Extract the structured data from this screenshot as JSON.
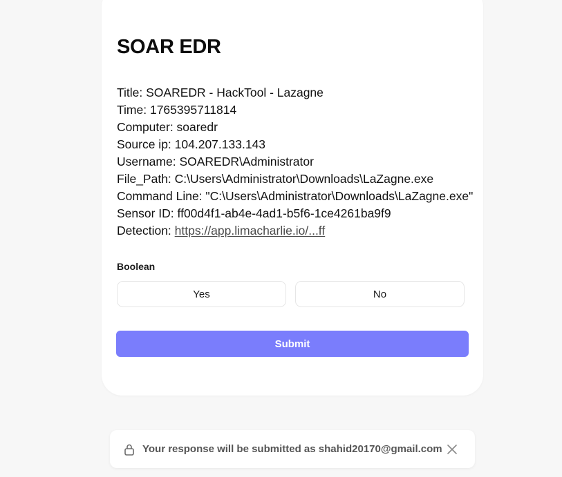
{
  "form": {
    "title": "SOAR EDR",
    "details": {
      "title": "Title: SOAREDR - HackTool - Lazagne",
      "time": "Time: 1765395711814",
      "computer": "Computer: soaredr",
      "source_ip": "Source ip: 104.207.133.143",
      "username": "Username: SOAREDR\\Administrator",
      "file_path": "File_Path: C:\\Users\\Administrator\\Downloads\\LaZagne.exe",
      "command_line": "Command Line: \"C:\\Users\\Administrator\\Downloads\\LaZagne.exe\"",
      "sensor_id": "Sensor ID: ff00d4f1-ab4e-4ad1-b5f6-1ce4261ba9f9",
      "detection_label": "Detection: ",
      "detection_link": "https://app.limacharlie.io/...ff"
    },
    "boolean_label": "Boolean",
    "options": {
      "yes": "Yes",
      "no": "No"
    },
    "submit_label": "Submit"
  },
  "toast": {
    "message": "Your response will be submitted as shahid20170@gmail.com",
    "lock_icon": "lock-icon",
    "close_icon": "close-icon"
  },
  "colors": {
    "background": "#f7f7f7",
    "card": "#ffffff",
    "submit": "#7a7dfc"
  }
}
